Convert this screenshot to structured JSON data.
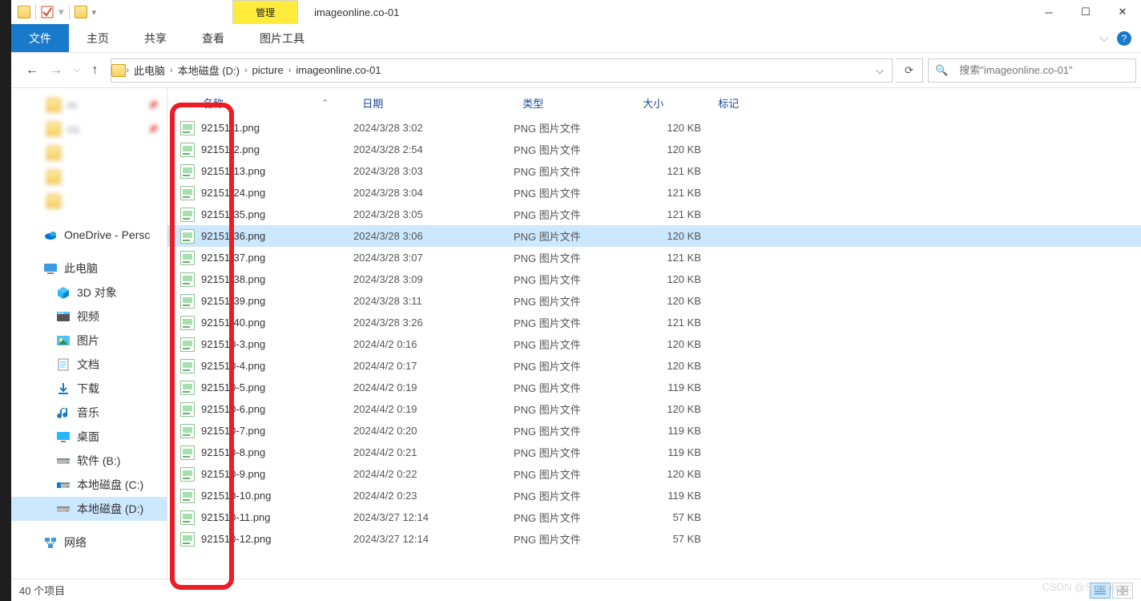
{
  "title_tab": "管理",
  "window_title": "imageonline.co-01",
  "ribbon": {
    "file": "文件",
    "tabs": [
      "主页",
      "共享",
      "查看",
      "图片工具"
    ]
  },
  "breadcrumb": [
    "此电脑",
    "本地磁盘 (D:)",
    "picture",
    "imageonline.co-01"
  ],
  "search_placeholder": "搜索\"imageonline.co-01\"",
  "tree": {
    "quick": [
      {
        "name": "rn",
        "pin": true,
        "blur": true
      },
      {
        "name": "co",
        "pin": true,
        "blur": true
      },
      {
        "name": "",
        "blur": true
      },
      {
        "name": "",
        "blur": true
      },
      {
        "name": "",
        "blur": true
      }
    ],
    "onedrive": "OneDrive - Persc",
    "thispc": "此电脑",
    "thispc_items": [
      {
        "name": "3D 对象",
        "icon": "cube"
      },
      {
        "name": "视频",
        "icon": "video"
      },
      {
        "name": "图片",
        "icon": "pictures"
      },
      {
        "name": "文档",
        "icon": "docs"
      },
      {
        "name": "下载",
        "icon": "download"
      },
      {
        "name": "音乐",
        "icon": "music"
      },
      {
        "name": "桌面",
        "icon": "desktop"
      },
      {
        "name": "软件 (B:)",
        "icon": "drive"
      },
      {
        "name": "本地磁盘 (C:)",
        "icon": "cdrive"
      },
      {
        "name": "本地磁盘 (D:)",
        "icon": "drive",
        "selected": true
      }
    ],
    "network": "网络"
  },
  "columns": {
    "name": "名称",
    "date": "日期",
    "type": "类型",
    "size": "大小",
    "tag": "标记"
  },
  "files": [
    {
      "name": "92151-1.png",
      "date": "2024/3/28 3:02",
      "type": "PNG 图片文件",
      "size": "120 KB"
    },
    {
      "name": "92151-2.png",
      "date": "2024/3/28 2:54",
      "type": "PNG 图片文件",
      "size": "120 KB"
    },
    {
      "name": "92151-13.png",
      "date": "2024/3/28 3:03",
      "type": "PNG 图片文件",
      "size": "121 KB"
    },
    {
      "name": "92151-24.png",
      "date": "2024/3/28 3:04",
      "type": "PNG 图片文件",
      "size": "121 KB"
    },
    {
      "name": "92151-35.png",
      "date": "2024/3/28 3:05",
      "type": "PNG 图片文件",
      "size": "121 KB"
    },
    {
      "name": "92151-36.png",
      "date": "2024/3/28 3:06",
      "type": "PNG 图片文件",
      "size": "120 KB",
      "selected": true
    },
    {
      "name": "92151-37.png",
      "date": "2024/3/28 3:07",
      "type": "PNG 图片文件",
      "size": "121 KB"
    },
    {
      "name": "92151-38.png",
      "date": "2024/3/28 3:09",
      "type": "PNG 图片文件",
      "size": "120 KB"
    },
    {
      "name": "92151-39.png",
      "date": "2024/3/28 3:11",
      "type": "PNG 图片文件",
      "size": "120 KB"
    },
    {
      "name": "92151-40.png",
      "date": "2024/3/28 3:26",
      "type": "PNG 图片文件",
      "size": "121 KB"
    },
    {
      "name": "921510-3.png",
      "date": "2024/4/2 0:16",
      "type": "PNG 图片文件",
      "size": "120 KB"
    },
    {
      "name": "921510-4.png",
      "date": "2024/4/2 0:17",
      "type": "PNG 图片文件",
      "size": "120 KB"
    },
    {
      "name": "921510-5.png",
      "date": "2024/4/2 0:19",
      "type": "PNG 图片文件",
      "size": "119 KB"
    },
    {
      "name": "921510-6.png",
      "date": "2024/4/2 0:19",
      "type": "PNG 图片文件",
      "size": "120 KB"
    },
    {
      "name": "921510-7.png",
      "date": "2024/4/2 0:20",
      "type": "PNG 图片文件",
      "size": "119 KB"
    },
    {
      "name": "921510-8.png",
      "date": "2024/4/2 0:21",
      "type": "PNG 图片文件",
      "size": "119 KB"
    },
    {
      "name": "921510-9.png",
      "date": "2024/4/2 0:22",
      "type": "PNG 图片文件",
      "size": "120 KB"
    },
    {
      "name": "921510-10.png",
      "date": "2024/4/2 0:23",
      "type": "PNG 图片文件",
      "size": "119 KB"
    },
    {
      "name": "921510-11.png",
      "date": "2024/3/27 12:14",
      "type": "PNG 图片文件",
      "size": "57 KB"
    },
    {
      "name": "921510-12.png",
      "date": "2024/3/27 12:14",
      "type": "PNG 图片文件",
      "size": "57 KB"
    }
  ],
  "status": "40 个项目",
  "watermark": "CSDN @SueMagic"
}
